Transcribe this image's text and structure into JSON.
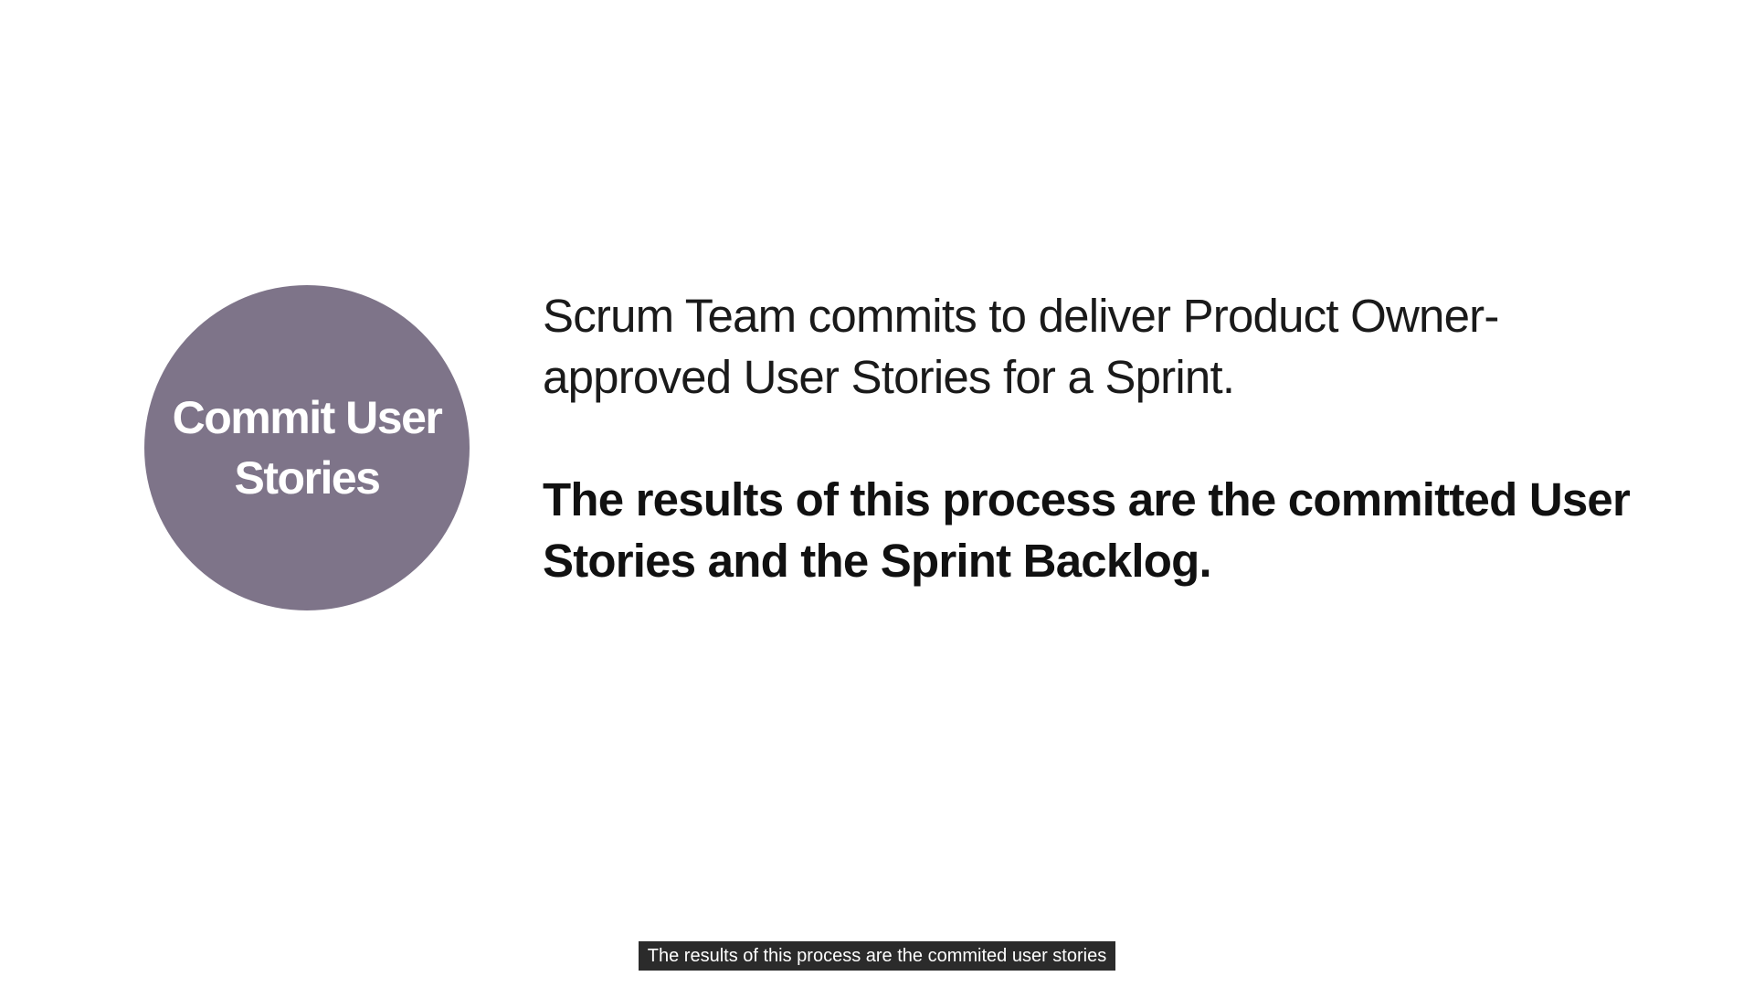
{
  "slide": {
    "circle_label": "Commit User Stories",
    "statement": "Scrum Team commits to deliver Product Owner-approved User Stories for a Sprint.",
    "result": "The results of this process are the committed User Stories and the Sprint Backlog."
  },
  "caption": {
    "text": "The results of this process are the commited user stories"
  },
  "colors": {
    "background": "#ffffff",
    "circle_fill": "#7e7489",
    "circle_text": "#ffffff",
    "body_text": "#1a1a1a",
    "caption_bg": "#2b2b2b",
    "caption_text": "#ffffff"
  }
}
